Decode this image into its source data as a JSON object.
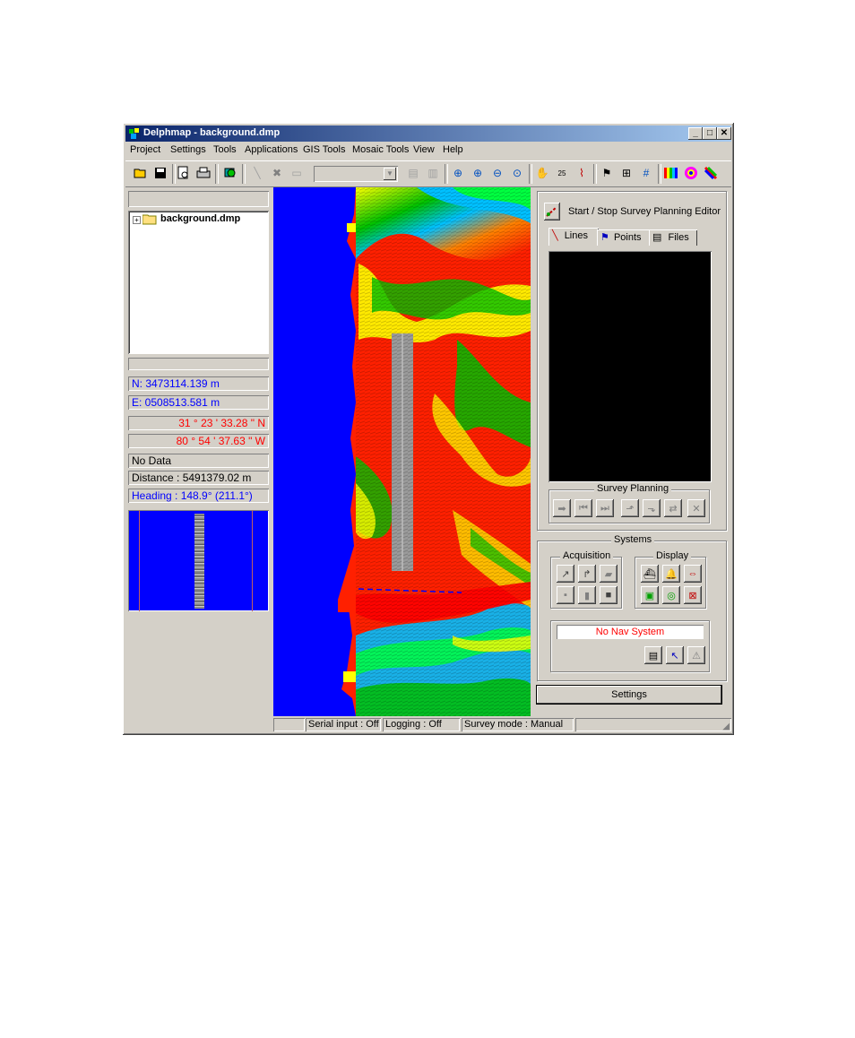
{
  "window": {
    "title": "Delphmap - background.dmp"
  },
  "menu": [
    "Project",
    "Settings",
    "Tools",
    "Applications",
    "GIS Tools",
    "Mosaic Tools",
    "View",
    "Help"
  ],
  "tree": {
    "root_label": "background.dmp"
  },
  "coords": {
    "north": "N: 3473114.139 m",
    "east": "E: 0508513.581 m",
    "lat": "31 ° 23 ' 33.28 \" N",
    "lon": "80 ° 54 ' 37.63 \" W",
    "data": "No Data",
    "distance": "Distance : 5491379.02 m",
    "heading": "Heading : 148.9° (211.1°)"
  },
  "survey_editor": {
    "toggle_label": "Start / Stop Survey Planning Editor",
    "tabs": [
      "Lines",
      "Points",
      "Files"
    ],
    "planning_group": "Survey Planning"
  },
  "systems": {
    "group": "Systems",
    "acquisition": "Acquisition",
    "display": "Display",
    "nav_status": "No Nav System"
  },
  "settings_button": "Settings",
  "status": {
    "serial": "Serial input : Off",
    "logging": "Logging : Off",
    "mode": "Survey mode : Manual"
  },
  "colors": {
    "title_start": "#0a246a",
    "title_end": "#a6caf0",
    "map_water": "#0000ff",
    "nav_status": "#ff0000",
    "coords_blue": "#0000ff",
    "coords_red": "#ff0000"
  }
}
